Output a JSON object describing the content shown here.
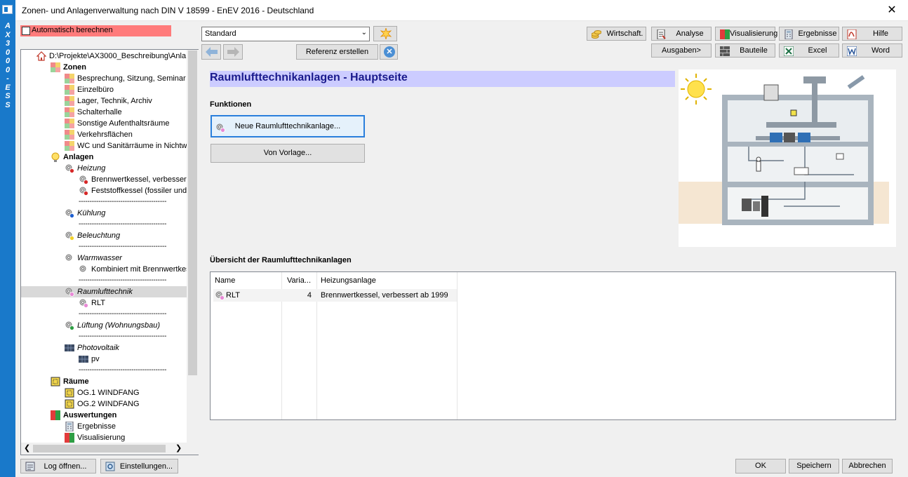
{
  "window": {
    "title": "Zonen- und Anlagenverwaltung nach DIN V 18599 - EnEV 2016 - Deutschland",
    "close_glyph": "✕",
    "side_label": "AX3000-ESS"
  },
  "auto_calc": {
    "label": "Automatisch berechnen",
    "checked": false
  },
  "toolbar": {
    "profile_select": "Standard",
    "referenz_label": "Referenz erstellen",
    "help_glyph": "?",
    "buttons": {
      "wirtschaft": "Wirtschaft.",
      "analyse": "Analyse",
      "visualisierung": "Visualisierung",
      "ergebnisse": "Ergebnisse",
      "hilfe": "Hilfe",
      "ausgaben": "Ausgaben>",
      "bauteile": "Bauteile",
      "excel": "Excel",
      "word": "Word"
    }
  },
  "tree": {
    "root": "D:\\Projekte\\AX3000_Beschreibung\\Anla",
    "zonen": {
      "label": "Zonen",
      "items": [
        "Besprechung, Sitzung, Seminar",
        "Einzelbüro",
        "Lager, Technik, Archiv",
        "Schalterhalle",
        "Sonstige Aufenthaltsräume",
        "Verkehrsflächen",
        "WC und Sanitärräume in Nichtwo"
      ]
    },
    "anlagen": {
      "label": "Anlagen",
      "heizung": "Heizung",
      "heizung_items": [
        "Brennwertkessel, verbesser",
        "Feststoffkessel (fossiler und"
      ],
      "kuehlung": "Kühlung",
      "beleuchtung": "Beleuchtung",
      "warmwasser": "Warmwasser",
      "warmwasser_items": [
        "Kombiniert mit Brennwertkes"
      ],
      "raumluft": "Raumlufttechnik",
      "raumluft_items": [
        "RLT"
      ],
      "lueftung": "Lüftung (Wohnungsbau)",
      "photovoltaik": "Photovoltaik",
      "photovoltaik_items": [
        "pv"
      ],
      "separator": "----------------------------------------"
    },
    "raeume": {
      "label": "Räume",
      "items": [
        "OG.1 WINDFANG",
        "OG.2 WINDFANG"
      ]
    },
    "auswertungen": {
      "label": "Auswertungen",
      "items": [
        "Ergebnisse",
        "Visualisierung"
      ]
    }
  },
  "content": {
    "heading": "Raumlufttechnikanlagen - Hauptseite",
    "functions_label": "Funktionen",
    "new_button": "Neue Raumlufttechnikanlage...",
    "template_button": "Von Vorlage...",
    "overview_label": "Übersicht der Raumlufttechnikanlagen",
    "table": {
      "columns": [
        "Name",
        "Varia...",
        "Heizungsanlage"
      ],
      "rows": [
        {
          "name": "RLT",
          "variant": "4",
          "heating": "Brennwertkessel, verbessert ab 1999"
        }
      ]
    }
  },
  "footer": {
    "log_button": "Log öffnen...",
    "settings_button": "Einstellungen...",
    "ok": "OK",
    "save": "Speichern",
    "cancel": "Abbrechen"
  },
  "colors": {
    "strip": "#1979ca",
    "autocalc_bg": "#ff7b7b",
    "heading_bg": "#ccccff",
    "heading_text": "#1a1a8c"
  }
}
